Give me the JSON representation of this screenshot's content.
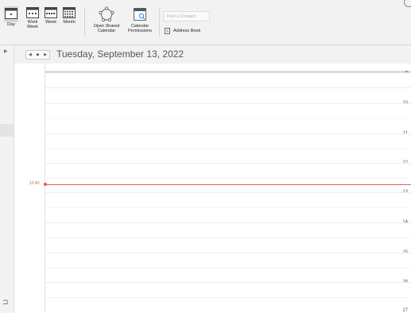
{
  "ribbon": {
    "views": [
      {
        "label": "Day",
        "active": true
      },
      {
        "label": "Work\nWeek",
        "active": false
      },
      {
        "label": "Week",
        "active": false
      },
      {
        "label": "Month",
        "active": false
      }
    ],
    "open_shared_calendar": "Open Shared\nCalendar",
    "calendar_permissions": "Calendar\nPermissions",
    "find_contact_placeholder": "Find a Contact",
    "address_book": "Address Book"
  },
  "header": {
    "date": "Tuesday, September 13, 2022"
  },
  "grid": {
    "top_label": "=",
    "hours": [
      "10",
      "11",
      "12",
      "13",
      "14",
      "15",
      "16",
      "17"
    ],
    "current_time": "12:43"
  },
  "colors": {
    "current_time": "#e55b5b",
    "ribbon_bg": "#f2f2f2"
  }
}
